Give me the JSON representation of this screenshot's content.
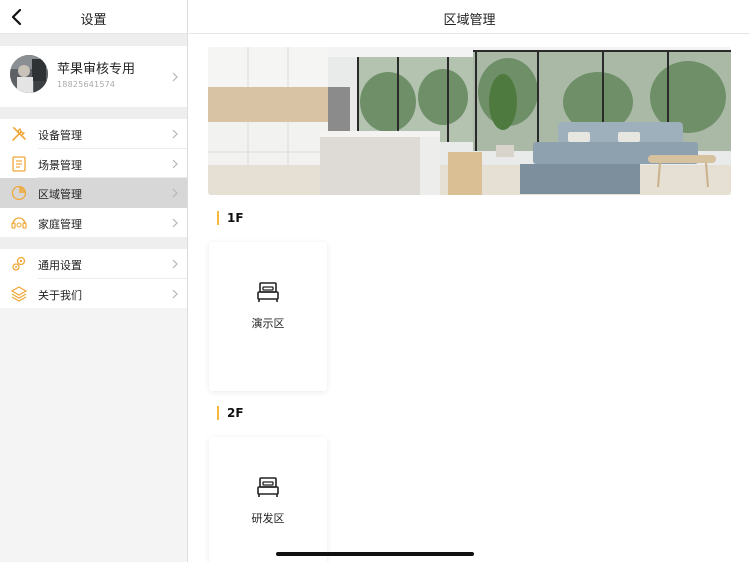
{
  "sidebar": {
    "title": "设置",
    "profile": {
      "name": "苹果审核专用",
      "phone": "18825641574"
    },
    "groups": [
      {
        "items": [
          {
            "label": "设备管理",
            "icon": "tools-icon"
          },
          {
            "label": "场景管理",
            "icon": "document-icon"
          },
          {
            "label": "区域管理",
            "icon": "pie-chart-icon",
            "active": true
          },
          {
            "label": "家庭管理",
            "icon": "family-icon"
          }
        ]
      },
      {
        "items": [
          {
            "label": "通用设置",
            "icon": "gears-icon"
          },
          {
            "label": "关于我们",
            "icon": "layers-icon"
          }
        ]
      }
    ]
  },
  "main": {
    "title": "区域管理",
    "floors": [
      {
        "name": "1F",
        "rooms": [
          {
            "name": "演示区",
            "icon": "bed-icon"
          }
        ]
      },
      {
        "name": "2F",
        "rooms": [
          {
            "name": "研发区",
            "icon": "bed-icon"
          }
        ]
      }
    ]
  },
  "colors": {
    "accent": "#f5b93d",
    "active_row": "#d7d7d7",
    "sidebar_bg": "#f4f4f4"
  }
}
